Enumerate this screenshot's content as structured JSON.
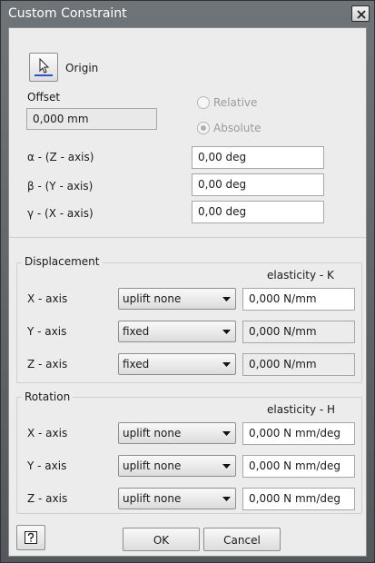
{
  "window": {
    "title": "Custom Constraint",
    "close_glyph": "✕"
  },
  "origin": {
    "label": "Origin",
    "icon": "origin-cursor-icon"
  },
  "offset": {
    "label": "Offset",
    "value": "0,000 mm"
  },
  "frame": {
    "relative_label": "Relative",
    "absolute_label": "Absolute",
    "selected": "Absolute"
  },
  "angles": {
    "alpha": {
      "label": "α - (Z - axis)",
      "value": "0,00 deg"
    },
    "beta": {
      "label": "β - (Y - axis)",
      "value": "0,00 deg"
    },
    "gamma": {
      "label": "γ - (X - axis)",
      "value": "0,00 deg"
    }
  },
  "displacement": {
    "title": "Displacement",
    "elasticity_header": "elasticity - K",
    "rows": [
      {
        "axis": "X - axis",
        "mode": "uplift none",
        "value": "0,000 N/mm",
        "editable": true
      },
      {
        "axis": "Y - axis",
        "mode": "fixed",
        "value": "0,000 N/mm",
        "editable": false
      },
      {
        "axis": "Z - axis",
        "mode": "fixed",
        "value": "0,000 N/mm",
        "editable": false
      }
    ]
  },
  "rotation": {
    "title": "Rotation",
    "elasticity_header": "elasticity - H",
    "rows": [
      {
        "axis": "X - axis",
        "mode": "uplift none",
        "value": "0,000 N mm/deg",
        "editable": true
      },
      {
        "axis": "Y - axis",
        "mode": "uplift none",
        "value": "0,000 N mm/deg",
        "editable": true
      },
      {
        "axis": "Z - axis",
        "mode": "uplift none",
        "value": "0,000 N mm/deg",
        "editable": true
      }
    ]
  },
  "buttons": {
    "ok": "OK",
    "cancel": "Cancel",
    "help_icon": "help-icon"
  },
  "colors": {
    "titlebar": "#5e6366",
    "client": "#ececec",
    "input": "#ffffff"
  }
}
